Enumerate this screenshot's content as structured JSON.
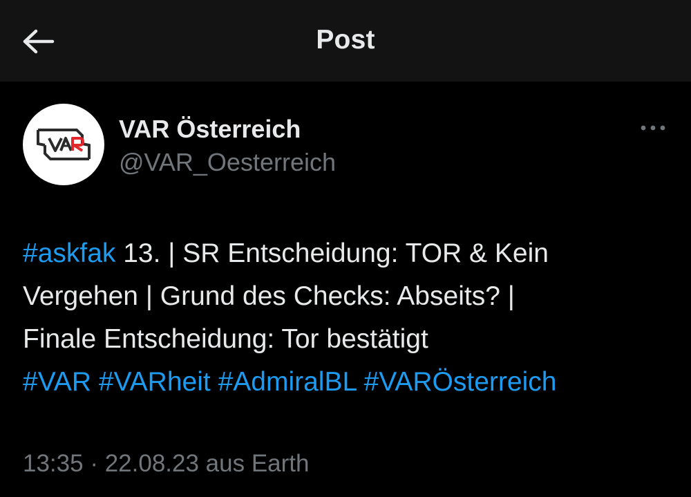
{
  "header": {
    "title": "Post",
    "back_icon": "arrow-left-icon"
  },
  "author": {
    "display_name": "VAR Österreich",
    "handle": "@VAR_Oesterreich",
    "avatar_logo_text": "VAR"
  },
  "post": {
    "line1": {
      "hashtag": "#askfak",
      "text": " 13. | SR Entscheidung: TOR & Kein"
    },
    "line2": "Vergehen | Grund des Checks: Abseits? |",
    "line3": "Finale Entscheidung: Tor bestätigt",
    "hashtags": [
      "#VAR",
      "#VARheit",
      "#AdmiralBL",
      "#VARÖsterreich"
    ]
  },
  "meta": {
    "time": "13:35",
    "separator": " · ",
    "date": "22.08.23",
    "source": " aus Earth"
  },
  "colors": {
    "background": "#000000",
    "header_background": "#131313",
    "text": "#e7e9ea",
    "secondary_text": "#71767b",
    "link": "#1d9bf0",
    "logo_red": "#e3262b"
  }
}
